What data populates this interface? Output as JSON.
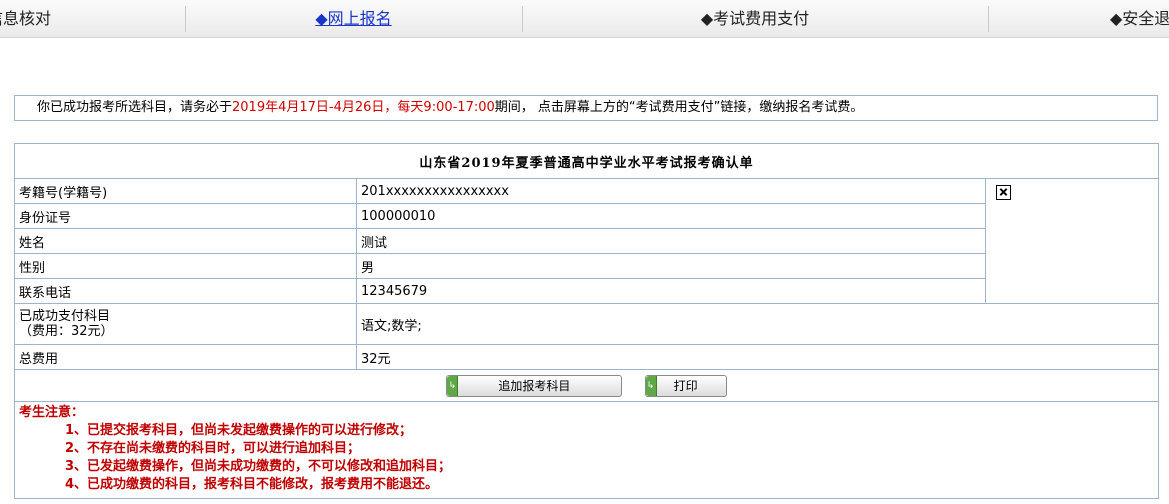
{
  "nav": {
    "tabs": [
      {
        "label": "信息核对"
      },
      {
        "label": "◆网上报名"
      },
      {
        "label": "◆考试费用支付"
      },
      {
        "label": "◆安全退出"
      }
    ]
  },
  "notice": {
    "prefix": "你已成功报考所选科目，请务必于",
    "highlight": "2019年4月17日-4月26日，每天9:00-17:00",
    "suffix": "期间， 点击屏幕上方的“考试费用支付”链接，缴纳报名考试费。"
  },
  "form": {
    "title": "山东省2019年夏季普通高中学业水平考试报考确认单",
    "fields": [
      {
        "label": "考籍号(学籍号)",
        "value": "201xxxxxxxxxxxxxxxx"
      },
      {
        "label": "身份证号",
        "value": "100000010"
      },
      {
        "label": "姓名",
        "value": "测试"
      },
      {
        "label": "性别",
        "value": "男"
      },
      {
        "label": "联系电话",
        "value": "12345679"
      }
    ],
    "paid_label_1": "已成功支付科目",
    "paid_label_2": "（费用：32元）",
    "paid_value": "语文;数学;",
    "total_label": "总费用",
    "total_value": "32元",
    "buttons": {
      "add": "追加报考科目",
      "print": "打印"
    },
    "notes": {
      "heading": "考生注意：",
      "items": [
        "1、已提交报考科目，但尚未发起缴费操作的可以进行修改；",
        "2、不存在尚未缴费的科目时，可以进行追加科目；",
        "3、已发起缴费操作，但尚未成功缴费的，不可以修改和追加科目；",
        "4、已成功缴费的科目，报考科目不能修改，报考费用不能退还。"
      ]
    }
  }
}
